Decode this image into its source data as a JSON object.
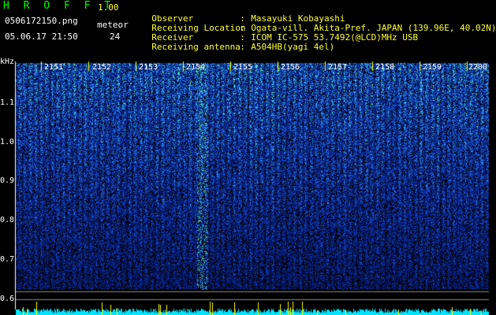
{
  "header": {
    "app_title": "H R O F F T",
    "app_version": "1.00",
    "file_name": "0506172150.png",
    "meteor_label": "meteor",
    "timestamp": "05.06.17 21:50",
    "meteor_count": "24"
  },
  "info": [
    {
      "label": "Observer",
      "value": "Masayuki Kobayashi"
    },
    {
      "label": "Receiving Location",
      "value": "Ogata-vill. Akita-Pref. JAPAN (139.96E, 40.02N)"
    },
    {
      "label": "Receiver",
      "value": "ICOM IC-575 53.7492(@LCD)MHz USB"
    },
    {
      "label": "Receiving antenna",
      "value": "A504HB(yagi 4el)"
    }
  ],
  "axis": {
    "unit_label": "kHz",
    "freq_ticks": [
      "1.1",
      "1.0",
      "0.9",
      "0.8",
      "0.7",
      "0.6"
    ],
    "minute_labels": [
      "2151",
      "2152",
      "2153",
      "2154",
      "2155",
      "2156",
      "2157",
      "2158",
      "2159",
      "2200"
    ]
  },
  "colors": {
    "bg": "#000000",
    "header_green": "#00ff00",
    "header_yellow": "#ffff33",
    "marker_yellow": "#ffff00",
    "baseline_cyan": "#00e5ff",
    "noise_dark": "#061a6e",
    "noise_mid": "#1a55d8",
    "noise_bright": "#34c8e8"
  }
}
